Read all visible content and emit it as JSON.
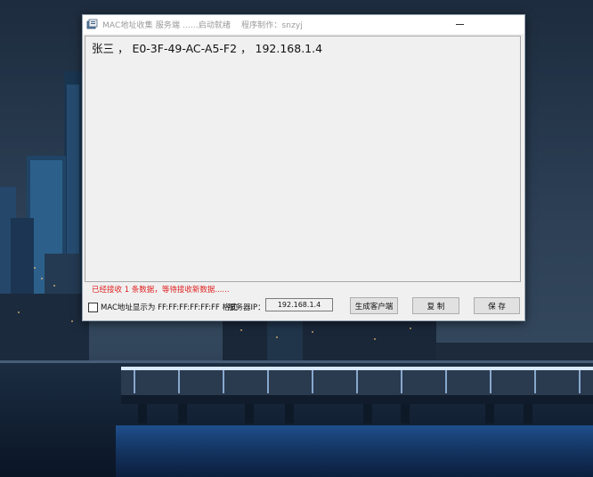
{
  "window": {
    "title": "MAC地址收集 服务端 ......启动就绪    程序制作：snzyj"
  },
  "content": {
    "line": "张三 ， E0-3F-49-AC-A5-F2 ， 192.168.1.4"
  },
  "status": {
    "text": "已经接收 1 条数据，等待接收新数据......",
    "color": "#e02020"
  },
  "controls": {
    "mac_format_label": "MAC地址显示为 FF:FF:FF:FF:FF:FF 格式",
    "mac_format_checked": false,
    "server_ip_label": "服务器IP：",
    "server_ip_value": "192.168.1.4",
    "generate_client_label": "生成客户端",
    "copy_label": "复 制",
    "save_label": "保 存"
  },
  "icons": {
    "app": "app-icon",
    "minimize": "minimize-icon"
  }
}
